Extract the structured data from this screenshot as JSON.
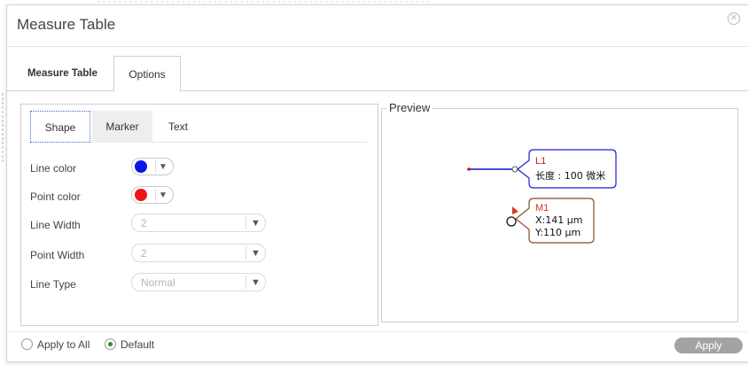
{
  "dialog": {
    "title": "Measure Table",
    "close_icon": "close-circle-icon"
  },
  "main_tabs": [
    {
      "label": "Measure Table",
      "active": false
    },
    {
      "label": "Options",
      "active": true
    }
  ],
  "sub_tabs": [
    {
      "label": "Shape",
      "active": true
    },
    {
      "label": "Marker",
      "active": false
    },
    {
      "label": "Text",
      "active": false
    }
  ],
  "shape": {
    "line_color": {
      "label": "Line color",
      "value": "#0a14e8"
    },
    "point_color": {
      "label": "Point color",
      "value": "#f01414"
    },
    "line_width": {
      "label": "Line Width",
      "value": "2"
    },
    "point_width": {
      "label": "Point Width",
      "value": "2"
    },
    "line_type": {
      "label": "Line Type",
      "value": "Normal"
    }
  },
  "preview": {
    "legend": "Preview",
    "line_callout": {
      "name": "L1",
      "text": "长度 : 100 微米"
    },
    "marker_callout": {
      "name": "M1",
      "x": "X:141 μm",
      "y": "Y:110 μm"
    },
    "colors": {
      "line": "#1010d8",
      "point": "#d81010",
      "marker_name": "#e03010",
      "callout_border_marker": "#8a4b2a"
    }
  },
  "footer": {
    "apply_all": {
      "label": "Apply to All",
      "checked": false
    },
    "default": {
      "label": "Default",
      "checked": true
    },
    "apply_button": "Apply"
  }
}
